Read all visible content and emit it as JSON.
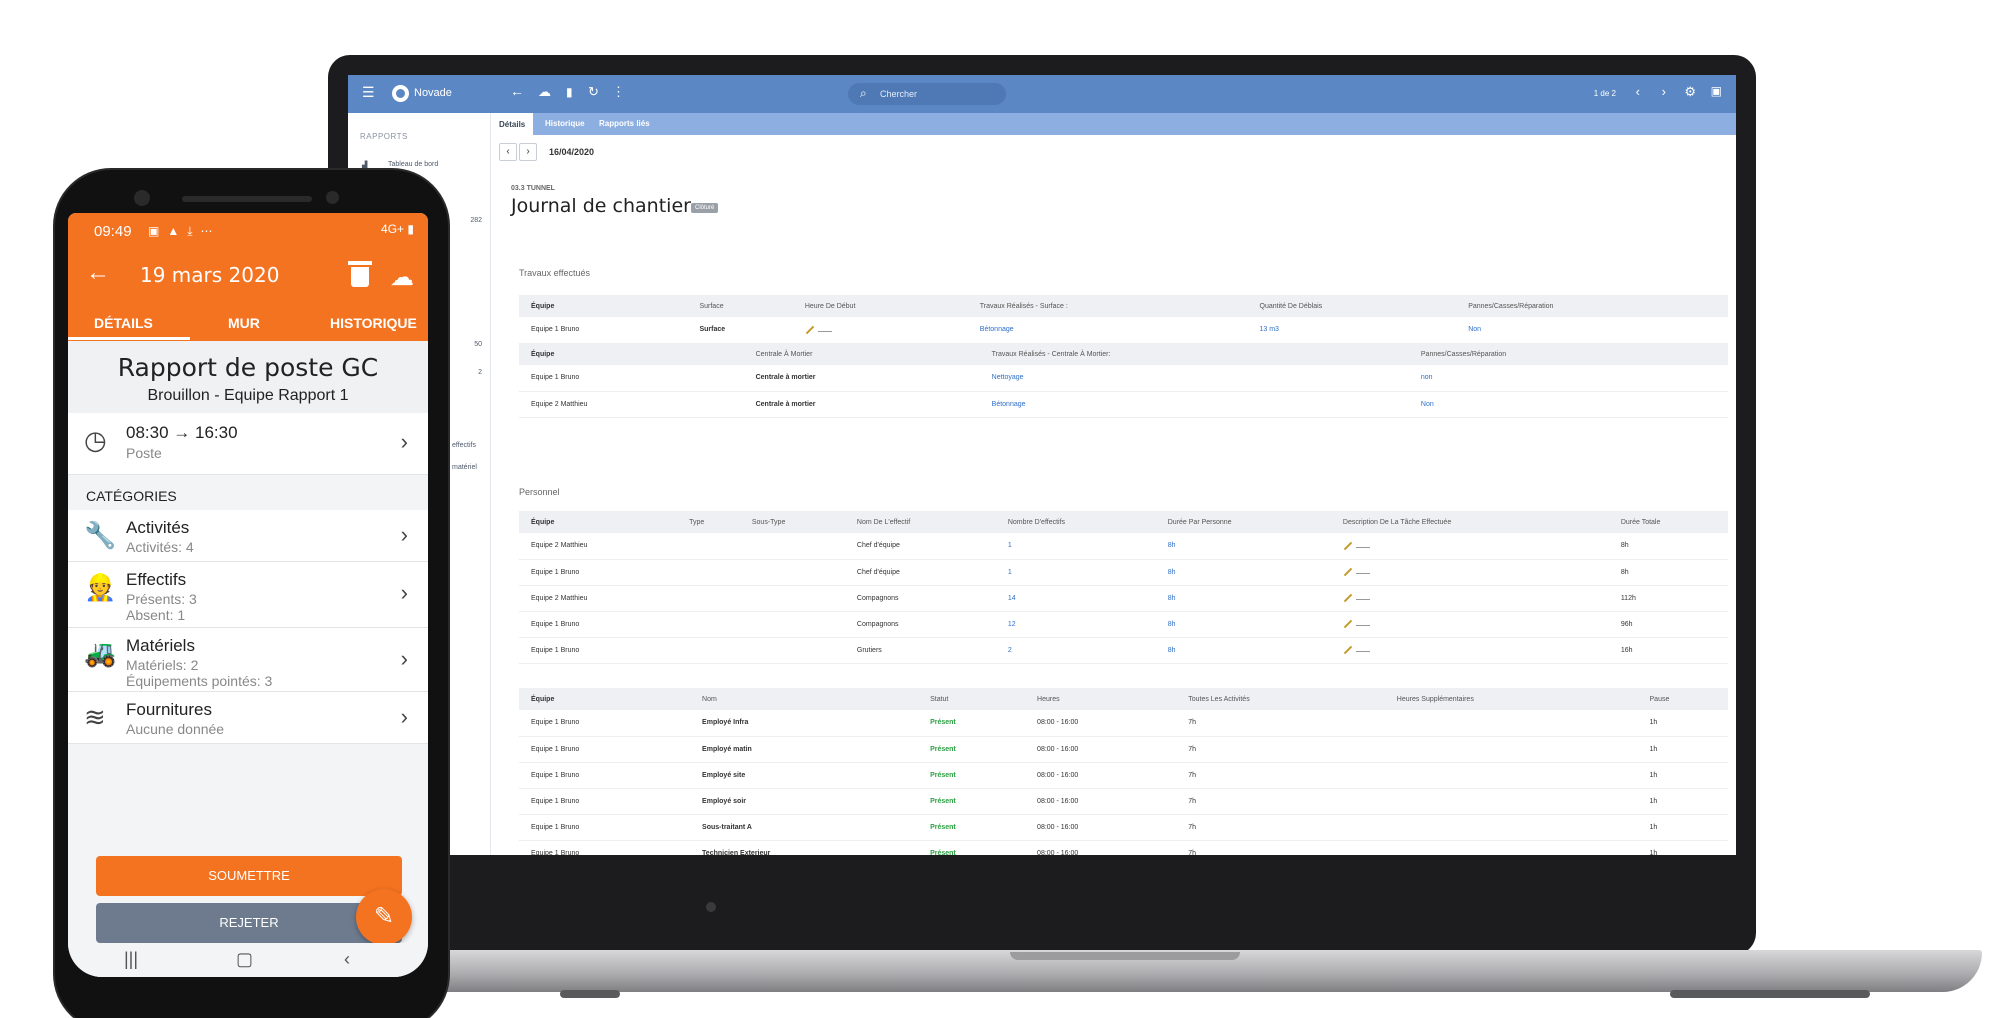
{
  "desktop": {
    "app_name": "Novade",
    "search": {
      "placeholder": "Chercher"
    },
    "pager": "1 de 2",
    "sidebar": {
      "section": "RAPPORTS",
      "items": [
        {
          "label": "Tableau de bord",
          "count": ""
        },
        {
          "label": "",
          "count": "282"
        },
        {
          "label": "",
          "count": "50"
        },
        {
          "label": "",
          "count": "2"
        },
        {
          "label": "effectifs",
          "count": ""
        },
        {
          "label": "matériel",
          "count": ""
        }
      ]
    },
    "tabs": [
      "Détails",
      "Historique",
      "Rapports liés"
    ],
    "date": "16/04/2020",
    "report": {
      "code": "03.3 TUNNEL",
      "title": "Journal de chantier",
      "badge": "Clôturé"
    },
    "travaux": {
      "title": "Travaux effectués",
      "table1": {
        "headers": [
          "Équipe",
          "Surface",
          "Heure De Début",
          "Travaux Réalisés - Surface :",
          "Quantité De Déblais",
          "Pannes/Casses/Réparation"
        ],
        "rows": [
          [
            "Equipe 1 Bruno",
            "Surface",
            "",
            "Bétonnage",
            "13 m3",
            "Non"
          ]
        ]
      },
      "table2": {
        "headers": [
          "Équipe",
          "Centrale À Mortier",
          "Travaux Réalisés - Centrale À Mortier:",
          "Pannes/Casses/Réparation"
        ],
        "rows": [
          [
            "Equipe 1 Bruno",
            "Centrale à mortier",
            "Nettoyage",
            "non"
          ],
          [
            "Equipe 2 Matthieu",
            "Centrale à mortier",
            "Bétonnage",
            "Non"
          ]
        ]
      }
    },
    "personnel": {
      "title": "Personnel",
      "headers": [
        "Équipe",
        "Type",
        "Sous-Type",
        "Nom De L'effectif",
        "Nombre D'effectifs",
        "Durée Par Personne",
        "Description De La Tâche Effectuée",
        "Durée Totale"
      ],
      "rows": [
        [
          "Equipe 2 Matthieu",
          "",
          "",
          "Chef d'équipe",
          "1",
          "8h",
          "",
          "8h"
        ],
        [
          "Equipe 1 Bruno",
          "",
          "",
          "Chef d'équipe",
          "1",
          "8h",
          "",
          "8h"
        ],
        [
          "Equipe 2 Matthieu",
          "",
          "",
          "Compagnons",
          "14",
          "8h",
          "",
          "112h"
        ],
        [
          "Equipe 1 Bruno",
          "",
          "",
          "Compagnons",
          "12",
          "8h",
          "",
          "96h"
        ],
        [
          "Equipe 1 Bruno",
          "",
          "",
          "Grutiers",
          "2",
          "8h",
          "",
          "16h"
        ]
      ]
    },
    "staff": {
      "headers": [
        "Équipe",
        "Nom",
        "Statut",
        "Heures",
        "Toutes Les Activités",
        "Heures Supplémentaires",
        "Pause"
      ],
      "rows": [
        [
          "Equipe 1 Bruno",
          "Employé Infra",
          "Présent",
          "08:00 - 16:00",
          "7h",
          "",
          "1h"
        ],
        [
          "Equipe 1 Bruno",
          "Employé matin",
          "Présent",
          "08:00 - 16:00",
          "7h",
          "",
          "1h"
        ],
        [
          "Equipe 1 Bruno",
          "Employé site",
          "Présent",
          "08:00 - 16:00",
          "7h",
          "",
          "1h"
        ],
        [
          "Equipe 1 Bruno",
          "Employé soir",
          "Présent",
          "08:00 - 16:00",
          "7h",
          "",
          "1h"
        ],
        [
          "Equipe 1 Bruno",
          "Sous-traitant A",
          "Présent",
          "08:00 - 16:00",
          "7h",
          "",
          "1h"
        ],
        [
          "Equipe 1 Bruno",
          "Technicien Exterieur",
          "Présent",
          "08:00 - 16:00",
          "7h",
          "",
          "1h"
        ]
      ]
    }
  },
  "mobile": {
    "status_time": "09:49",
    "status_right": "4G+ ▮",
    "header_title": "19 mars 2020",
    "tabs": [
      "DÉTAILS",
      "MUR",
      "HISTORIQUE"
    ],
    "report_title": "Rapport de poste GC",
    "report_subtitle": "Brouillon - Equipe Rapport 1",
    "shift": {
      "time": "08:30 → 16:30",
      "label": "Poste"
    },
    "categories_label": "CATÉGORIES",
    "categories": [
      {
        "title": "Activités",
        "lines": [
          "Activités: 4"
        ]
      },
      {
        "title": "Effectifs",
        "lines": [
          "Présents: 3",
          "Absent: 1"
        ]
      },
      {
        "title": "Matériels",
        "lines": [
          "Matériels: 2",
          "Équipements pointés: 3"
        ]
      },
      {
        "title": "Fournitures",
        "lines": [
          "Aucune donnée"
        ]
      }
    ],
    "submit_label": "SOUMETTRE",
    "reject_label": "REJETER"
  },
  "colors": {
    "brand_orange": "#f47321",
    "desktop_topbar": "#5b87c4",
    "link_blue": "#2f6fc8",
    "present_green": "#2ea043"
  }
}
